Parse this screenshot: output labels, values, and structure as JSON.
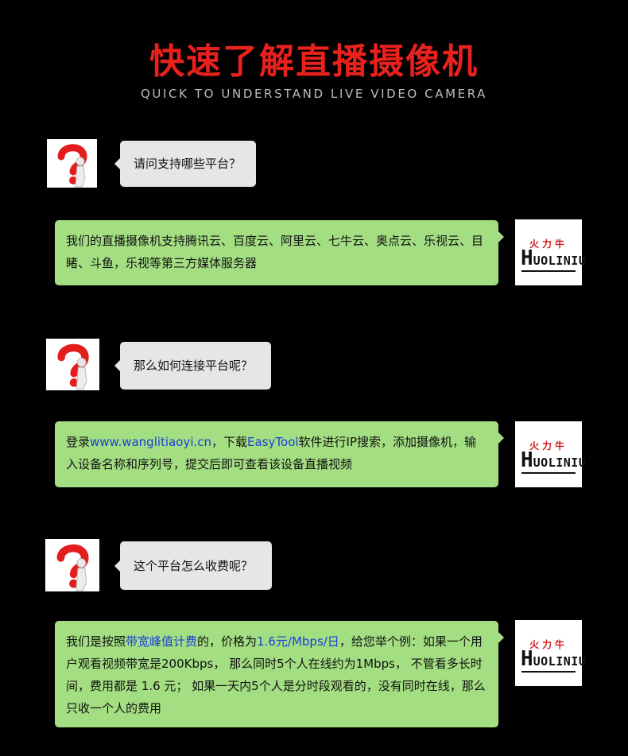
{
  "header": {
    "title": "快速了解直播摄像机",
    "subtitle": "QUICK TO UNDERSTAND LIVE VIDEO CAMERA"
  },
  "logo": {
    "top_text": "火力牛",
    "h": "H",
    "rest": "UOLINIU"
  },
  "qa": [
    {
      "question": "请问支持哪些平台？",
      "answer": "我们的直播摄像机支持腾讯云、百度云、阿里云、七牛云、奥点云、乐视云、目睹、斗鱼，乐视等第三方媒体服务器"
    },
    {
      "question": "那么如何连接平台呢？",
      "answer_parts": {
        "p1": "登录",
        "link1": "www.wanglitiaoyi.cn",
        "p2": "，下载",
        "link2": "EasyTool",
        "p3": "软件进行IP搜索，添加摄像机，输入设备名称和序列号，提交后即可查看该设备直播视频"
      }
    },
    {
      "question": "这个平台怎么收费呢？",
      "answer_parts": {
        "p1": "我们是按照",
        "hl1": "带宽峰值计费",
        "p2": "的，价格为",
        "hl2": "1.6元/Mbps/日",
        "p3": "，给您举个例：如果一个用户观看视频带宽是200Kbps， 那么同时5个人在线约为1Mbps， 不管看多长时间，费用都是 1.6 元； 如果一天内5个人是分时段观看的，没有同时在线，那么只收一个人的费用"
      }
    }
  ],
  "colors": {
    "title": "#e8211d",
    "question_bubble": "#e6e6e6",
    "answer_bubble": "#a4de82",
    "highlight": "#1a3fd6"
  }
}
